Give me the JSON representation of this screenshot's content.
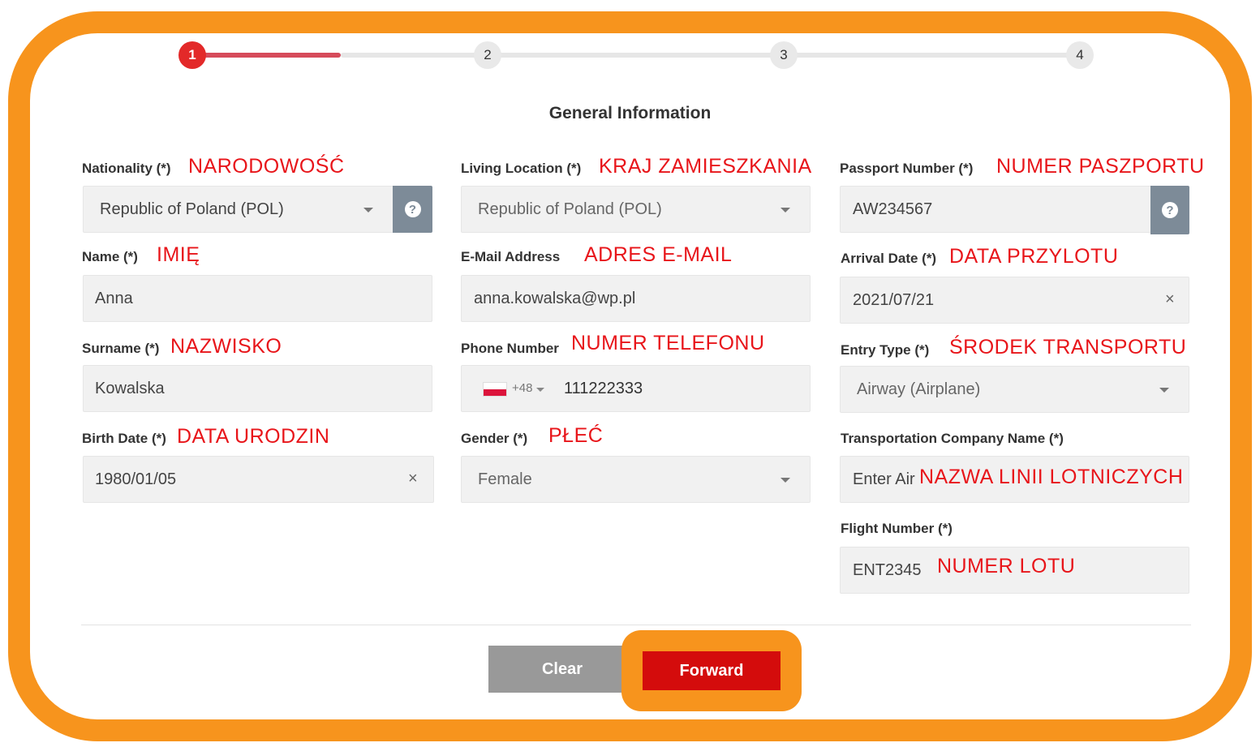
{
  "stepper": {
    "steps": [
      "1",
      "2",
      "3",
      "4"
    ],
    "active_step": 1
  },
  "section_title": "General Information",
  "fields": {
    "nationality": {
      "label": "Nationality (*)",
      "annotation": "NARODOWOŚĆ",
      "value": "Republic of Poland (POL)"
    },
    "living_location": {
      "label": "Living Location (*)",
      "annotation": "KRAJ ZAMIESZKANIA",
      "value": "Republic of Poland (POL)"
    },
    "passport_number": {
      "label": "Passport Number (*)",
      "annotation": "NUMER PASZPORTU",
      "value": "AW234567"
    },
    "name": {
      "label": "Name (*)",
      "annotation": "IMIĘ",
      "value": "Anna"
    },
    "email": {
      "label": "E-Mail Address",
      "annotation": "ADRES E-MAIL",
      "value": "anna.kowalska@wp.pl"
    },
    "arrival_date": {
      "label": "Arrival Date (*)",
      "annotation": "DATA PRZYLOTU",
      "value": "2021/07/21"
    },
    "surname": {
      "label": "Surname (*)",
      "annotation": "NAZWISKO",
      "value": "Kowalska"
    },
    "phone": {
      "label": "Phone Number",
      "annotation": "NUMER TELEFONU",
      "country_code": "+48",
      "value": "111222333"
    },
    "entry_type": {
      "label": "Entry Type (*)",
      "annotation": "ŚRODEK TRANSPORTU",
      "value": "Airway (Airplane)"
    },
    "birth_date": {
      "label": "Birth Date (*)",
      "annotation": "DATA URODZIN",
      "value": "1980/01/05"
    },
    "gender": {
      "label": "Gender (*)",
      "annotation": "PŁEĆ",
      "value": "Female"
    },
    "transport_company": {
      "label": "Transportation Company Name (*)",
      "annotation": "NAZWA LINII LOTNICZYCH",
      "value": "Enter Air"
    },
    "flight_number": {
      "label": "Flight Number (*)",
      "annotation": "NUMER LOTU",
      "value": "ENT2345"
    }
  },
  "buttons": {
    "clear": "Clear",
    "forward": "Forward"
  },
  "icons": {
    "help": "?",
    "clear_x": "×"
  },
  "colors": {
    "highlight": "#f7941d",
    "annotation": "#e8151a",
    "active_step": "#e32929",
    "forward": "#d40c0c",
    "clear": "#999999"
  }
}
